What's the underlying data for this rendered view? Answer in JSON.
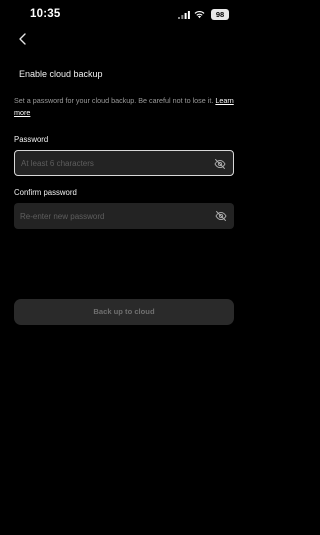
{
  "status_bar": {
    "time": "10:35",
    "battery": "98",
    "signal_icon": "cellular-signal-icon",
    "wifi_icon": "wifi-icon"
  },
  "header": {
    "back_icon": "chevron-left-icon",
    "title": "Enable cloud backup"
  },
  "description": {
    "text": "Set a password for your cloud backup. Be careful not to lose it.",
    "link": "Learn more"
  },
  "fields": {
    "password": {
      "label": "Password",
      "value": "",
      "placeholder": "At least 6 characters",
      "toggle_icon": "eye-off-icon"
    },
    "confirm": {
      "label": "Confirm password",
      "value": "",
      "placeholder": "Re-enter new password",
      "toggle_icon": "eye-off-icon"
    }
  },
  "cta": {
    "label": "Back up to cloud"
  },
  "colors": {
    "background": "#000000",
    "field_bg": "#232323",
    "focus_border": "#d8d8d8",
    "placeholder": "#5e5e5e",
    "cta_bg": "#2a2a2a",
    "cta_text": "#6f6f6f"
  }
}
